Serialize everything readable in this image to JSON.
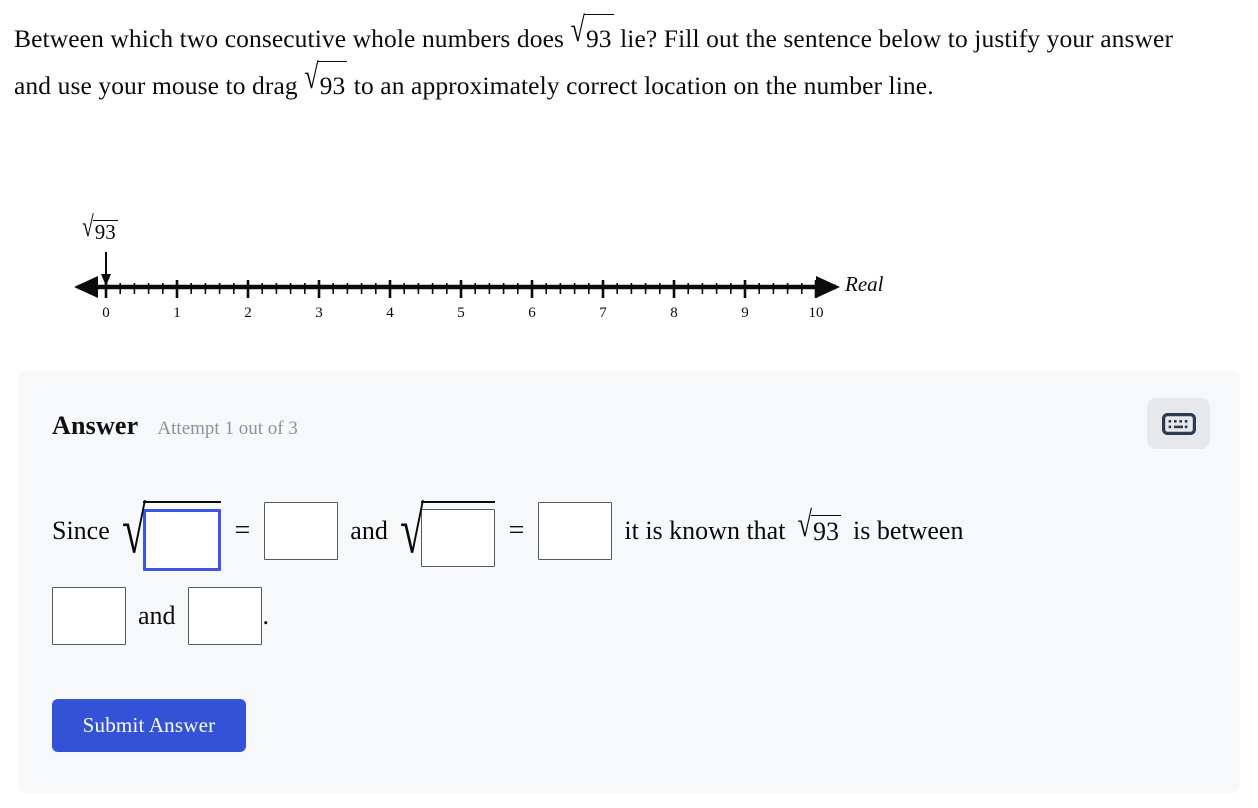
{
  "question": {
    "part1": "Between which two consecutive whole numbers does",
    "radical_symbol": "√",
    "radicand": "93",
    "part2": "lie? Fill out the sentence",
    "part3": "below to justify your answer and use your mouse to drag",
    "part4": "to an approximately",
    "part5": "correct location on the number line."
  },
  "number_line": {
    "drag_label_symbol": "√",
    "drag_label_radicand": "93",
    "axis_label": "Real",
    "tick_labels": [
      "0",
      "1",
      "2",
      "3",
      "4",
      "5",
      "6",
      "7",
      "8",
      "9",
      "10"
    ],
    "min": 0,
    "max": 10,
    "minor_ticks_per_unit": 5,
    "drag_marker_position": 0,
    "arrow_both_ends": true
  },
  "answer_panel": {
    "title": "Answer",
    "attempt_text": "Attempt 1 out of 3",
    "keyboard_button_icon": "keyboard-icon",
    "background_color": "#f7f8fa"
  },
  "sentence": {
    "since": "Since",
    "equals1": "=",
    "and1": "and",
    "equals2": "=",
    "it_is_known_that": "it is known that",
    "radical_symbol": "√",
    "radicand": "93",
    "is_between": "is between",
    "and2": "and",
    "period": "."
  },
  "inputs": {
    "radicand1": {
      "value": "",
      "focused": true
    },
    "result1": {
      "value": "",
      "focused": false
    },
    "radicand2": {
      "value": "",
      "focused": false
    },
    "result2": {
      "value": "",
      "focused": false
    },
    "lower_bound": {
      "value": "",
      "focused": false
    },
    "upper_bound": {
      "value": "",
      "focused": false
    }
  },
  "submit": {
    "label": "Submit Answer",
    "color": "#3352d8"
  },
  "colors": {
    "focus_blue": "#4054e8",
    "panel_bg": "#f7f8fa",
    "muted_text": "#8b93a1",
    "keyboard_icon": "#2e3a4f"
  }
}
